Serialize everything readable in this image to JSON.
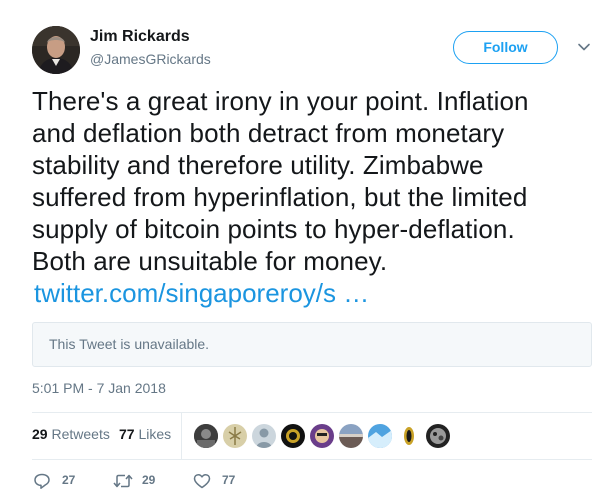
{
  "user": {
    "name": "Jim Rickards",
    "handle": "@JamesGRickards",
    "follow_label": "Follow"
  },
  "tweet": {
    "lines": [
      "There's a great irony in your point. Inflation",
      "and deflation both detract from monetary",
      "stability and therefore utility. Zimbabwe",
      "suffered from hyperinflation, but the limited",
      "supply of bitcoin points to hyper-deflation.",
      "Both are unsuitable for money."
    ],
    "link": "twitter.com/singaporeroy/s …",
    "quote_unavailable": "This Tweet is unavailable.",
    "timestamp": "5:01 PM - 7 Jan 2018"
  },
  "stats": {
    "retweets_count": "29",
    "retweets_label": "Retweets",
    "likes_count": "77",
    "likes_label": "Likes"
  },
  "likers": [
    "liker-1",
    "liker-2",
    "liker-3",
    "liker-4",
    "liker-5",
    "liker-6",
    "liker-7",
    "liker-8",
    "liker-9"
  ],
  "actions": {
    "reply_count": "27",
    "retweet_count": "29",
    "like_count": "77"
  },
  "colors": {
    "accent": "#1da1f2",
    "link": "#1b95e0",
    "secondary_text": "#657786",
    "border": "#e6ecf0"
  },
  "icons": [
    "chevron-down-icon",
    "reply-icon",
    "retweet-icon",
    "heart-icon"
  ]
}
